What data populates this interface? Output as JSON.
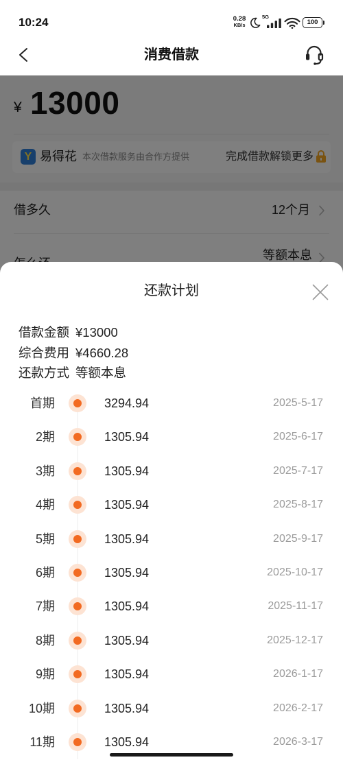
{
  "status_bar": {
    "time": "10:24",
    "net_speed": {
      "value": "0.28",
      "unit": "KB/s"
    },
    "network_type": "5G",
    "battery_level": "100",
    "icons": [
      "moon-icon",
      "signal-icon",
      "wifi-icon",
      "battery-icon"
    ]
  },
  "header": {
    "title": "消费借款",
    "back_icon": "chevron-left-icon",
    "service_icon": "headset-icon"
  },
  "loan_page": {
    "currency_symbol": "¥",
    "amount": "13000",
    "partner": {
      "logo_letter": "Y",
      "name": "易得花",
      "note": "本次借款服务由合作方提供",
      "unlock_text": "完成借款解锁更多",
      "lock_icon": "lock-icon"
    },
    "rows": [
      {
        "label": "借多久",
        "value": "12个月"
      },
      {
        "label": "怎么还",
        "value": "等额本息"
      }
    ]
  },
  "plan_sheet": {
    "title": "还款计划",
    "close_icon": "close-icon",
    "summary": [
      {
        "label": "借款金额",
        "value": "¥13000"
      },
      {
        "label": "综合费用",
        "value": "¥4660.28"
      },
      {
        "label": "还款方式",
        "value": "等额本息"
      }
    ],
    "installments": [
      {
        "period": "首期",
        "amount": "3294.94",
        "date": "2025-5-17"
      },
      {
        "period": "2期",
        "amount": "1305.94",
        "date": "2025-6-17"
      },
      {
        "period": "3期",
        "amount": "1305.94",
        "date": "2025-7-17"
      },
      {
        "period": "4期",
        "amount": "1305.94",
        "date": "2025-8-17"
      },
      {
        "period": "5期",
        "amount": "1305.94",
        "date": "2025-9-17"
      },
      {
        "period": "6期",
        "amount": "1305.94",
        "date": "2025-10-17"
      },
      {
        "period": "7期",
        "amount": "1305.94",
        "date": "2025-11-17"
      },
      {
        "period": "8期",
        "amount": "1305.94",
        "date": "2025-12-17"
      },
      {
        "period": "9期",
        "amount": "1305.94",
        "date": "2026-1-17"
      },
      {
        "period": "10期",
        "amount": "1305.94",
        "date": "2026-2-17"
      },
      {
        "period": "11期",
        "amount": "1305.94",
        "date": "2026-3-17"
      }
    ]
  },
  "colors": {
    "accent": "#f26a21",
    "accent_halo": "#fde3d3",
    "date_text": "#9b9b9b",
    "brand_blue": "#2e7fd9",
    "lock": "#f5a623",
    "overlay": "rgba(0,0,0,0.5)"
  }
}
